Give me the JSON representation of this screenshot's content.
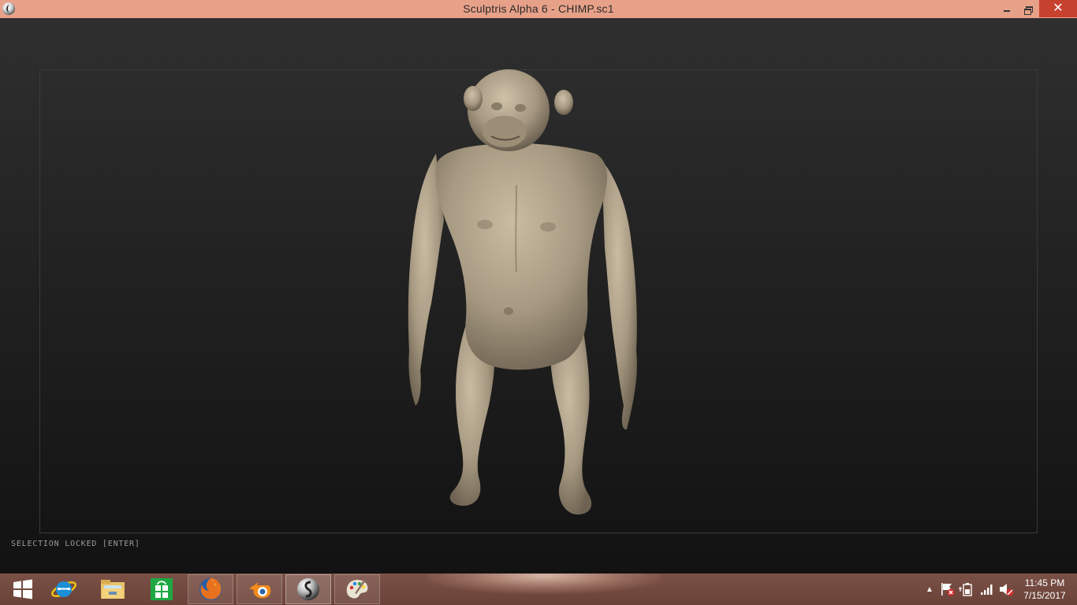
{
  "window": {
    "title": "Sculptris Alpha 6 - CHIMP.sc1",
    "minimize_label": "",
    "maximize_label": "",
    "close_label": "✕"
  },
  "viewport": {
    "status_text": "SELECTION LOCKED [ENTER]",
    "model_color": "#a89a82"
  },
  "taskbar": {
    "color": "#6e463c",
    "apps": [
      {
        "name": "start-button",
        "icon": "windows-logo-icon"
      },
      {
        "name": "internet-explorer",
        "icon": "internet-explorer-icon"
      },
      {
        "name": "file-explorer",
        "icon": "folder-icon"
      },
      {
        "name": "windows-store",
        "icon": "store-icon"
      },
      {
        "name": "firefox",
        "icon": "firefox-icon"
      },
      {
        "name": "blender",
        "icon": "blender-icon"
      },
      {
        "name": "sculptris",
        "icon": "sculptris-icon"
      },
      {
        "name": "paint",
        "icon": "paint-palette-icon"
      }
    ],
    "clock": {
      "time": "11:45 PM",
      "date": "7/15/2017"
    }
  }
}
